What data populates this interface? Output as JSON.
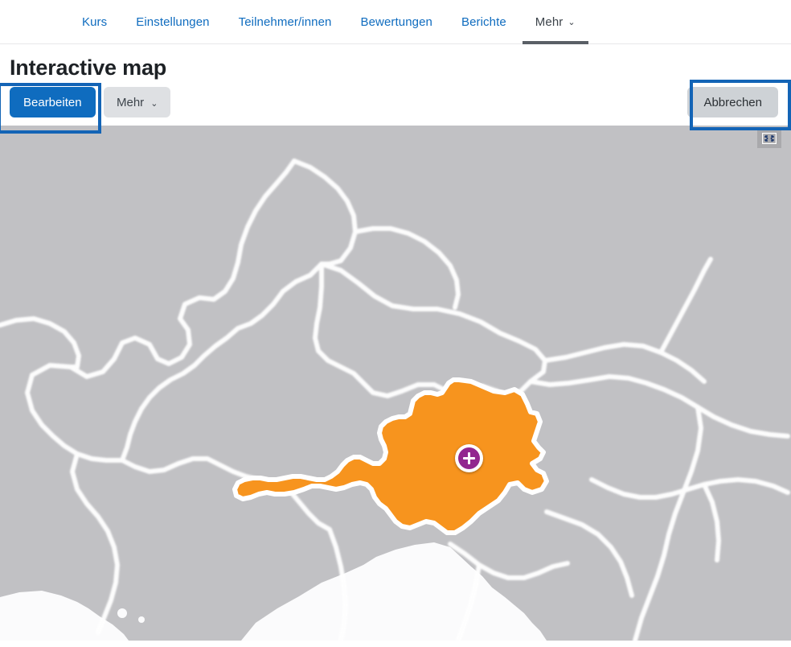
{
  "nav": {
    "items": [
      {
        "label": "Kurs",
        "active": false,
        "caret": ""
      },
      {
        "label": "Einstellungen",
        "active": false,
        "caret": ""
      },
      {
        "label": "Teilnehmer/innen",
        "active": false,
        "caret": ""
      },
      {
        "label": "Bewertungen",
        "active": false,
        "caret": ""
      },
      {
        "label": "Berichte",
        "active": false,
        "caret": ""
      },
      {
        "label": "Mehr",
        "active": true,
        "caret": "⌄"
      }
    ]
  },
  "page": {
    "title": "Interactive map"
  },
  "toolbar": {
    "edit_label": "Bearbeiten",
    "more_label": "Mehr",
    "more_caret": "⌄",
    "cancel_label": "Abbrechen"
  },
  "map": {
    "fullscreen_icon": "fullscreen-icon",
    "marker_icon": "add-marker-icon",
    "highlighted_region": "Austria",
    "colors": {
      "land": "#c1c1c4",
      "water": "#ffffff",
      "border": "#ffffff",
      "highlight": "#f7941e",
      "marker": "#92278f",
      "accent": "#0f6cbf",
      "annotation": "#1364b6"
    }
  },
  "annotations": [
    {
      "name": "edit-button-highlight",
      "target": "Bearbeiten"
    },
    {
      "name": "cancel-button-highlight",
      "target": "Abbrechen"
    }
  ]
}
